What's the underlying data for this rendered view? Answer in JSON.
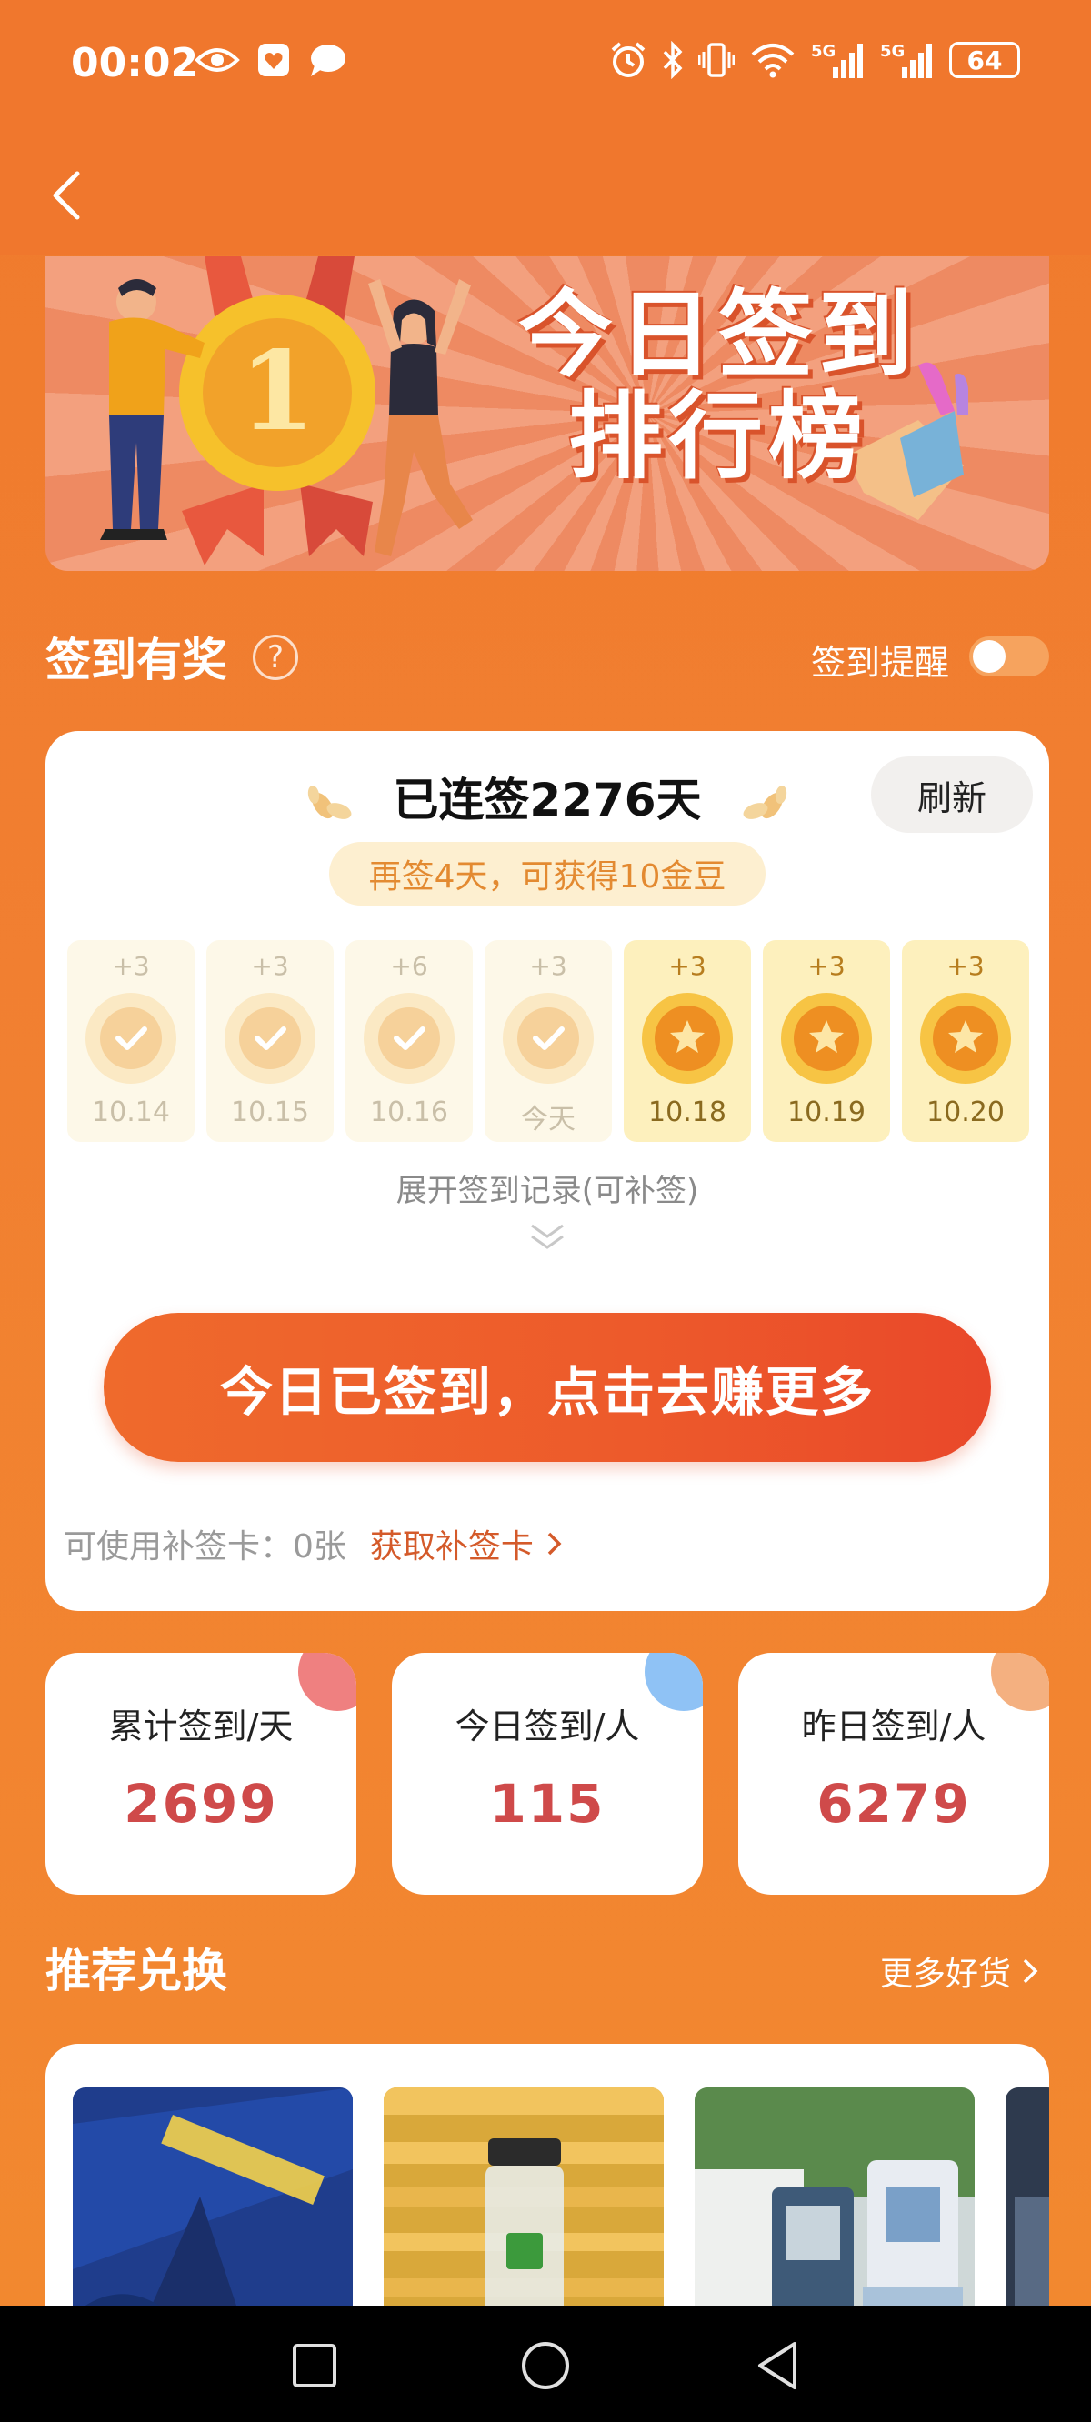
{
  "status_bar": {
    "time": "00:02",
    "battery": "64",
    "left_icons": [
      "eye-icon",
      "shield-heart-icon",
      "chat-bubble-icon"
    ],
    "right_icons": [
      "alarm-icon",
      "bluetooth-icon",
      "vibrate-icon",
      "wifi-icon",
      "signal-5g-icon",
      "signal-5g-icon"
    ],
    "signal_labels": [
      "5G",
      "5G"
    ]
  },
  "nav": {
    "back_icon": "chevron-left-icon"
  },
  "banner": {
    "title_line1": "今日签到",
    "title_line2": "排行榜",
    "medal_number": "1"
  },
  "rewards_section": {
    "title": "签到有奖",
    "help_icon": "question-circle-icon",
    "help_glyph": "?",
    "reminder_label": "签到提醒",
    "reminder_on": false
  },
  "checkin": {
    "streak_text": "已连签2276天",
    "refresh_label": "刷新",
    "hint_text": "再签4天，可获得10金豆",
    "days": [
      {
        "bonus": "+3",
        "date": "10.14",
        "state": "checked"
      },
      {
        "bonus": "+3",
        "date": "10.15",
        "state": "checked"
      },
      {
        "bonus": "+6",
        "date": "10.16",
        "state": "checked"
      },
      {
        "bonus": "+3",
        "date": "今天",
        "state": "checked"
      },
      {
        "bonus": "+3",
        "date": "10.18",
        "state": "future"
      },
      {
        "bonus": "+3",
        "date": "10.19",
        "state": "future"
      },
      {
        "bonus": "+3",
        "date": "10.20",
        "state": "future"
      }
    ],
    "expand_label": "展开签到记录(可补签)",
    "main_button_label": "今日已签到，点击去赚更多",
    "makeup_count_text": "可使用补签卡：0张",
    "makeup_link_label": "获取补签卡"
  },
  "stats": [
    {
      "label": "累计签到/天",
      "value": "2699",
      "dot_color": "#ef8080"
    },
    {
      "label": "今日签到/人",
      "value": "115",
      "dot_color": "#8fc2f5"
    },
    {
      "label": "昨日签到/人",
      "value": "6279",
      "dot_color": "#f4b080"
    }
  ],
  "recommend": {
    "title": "推荐兑换",
    "more_label": "更多好货",
    "products": [
      "umbrella",
      "water-bottle",
      "qr-stand"
    ]
  },
  "colors": {
    "bg_orange": "#f07a2c",
    "accent_red": "#e9482a",
    "stat_value": "#cf4a4a",
    "coin_gold": "#f2a22a"
  }
}
